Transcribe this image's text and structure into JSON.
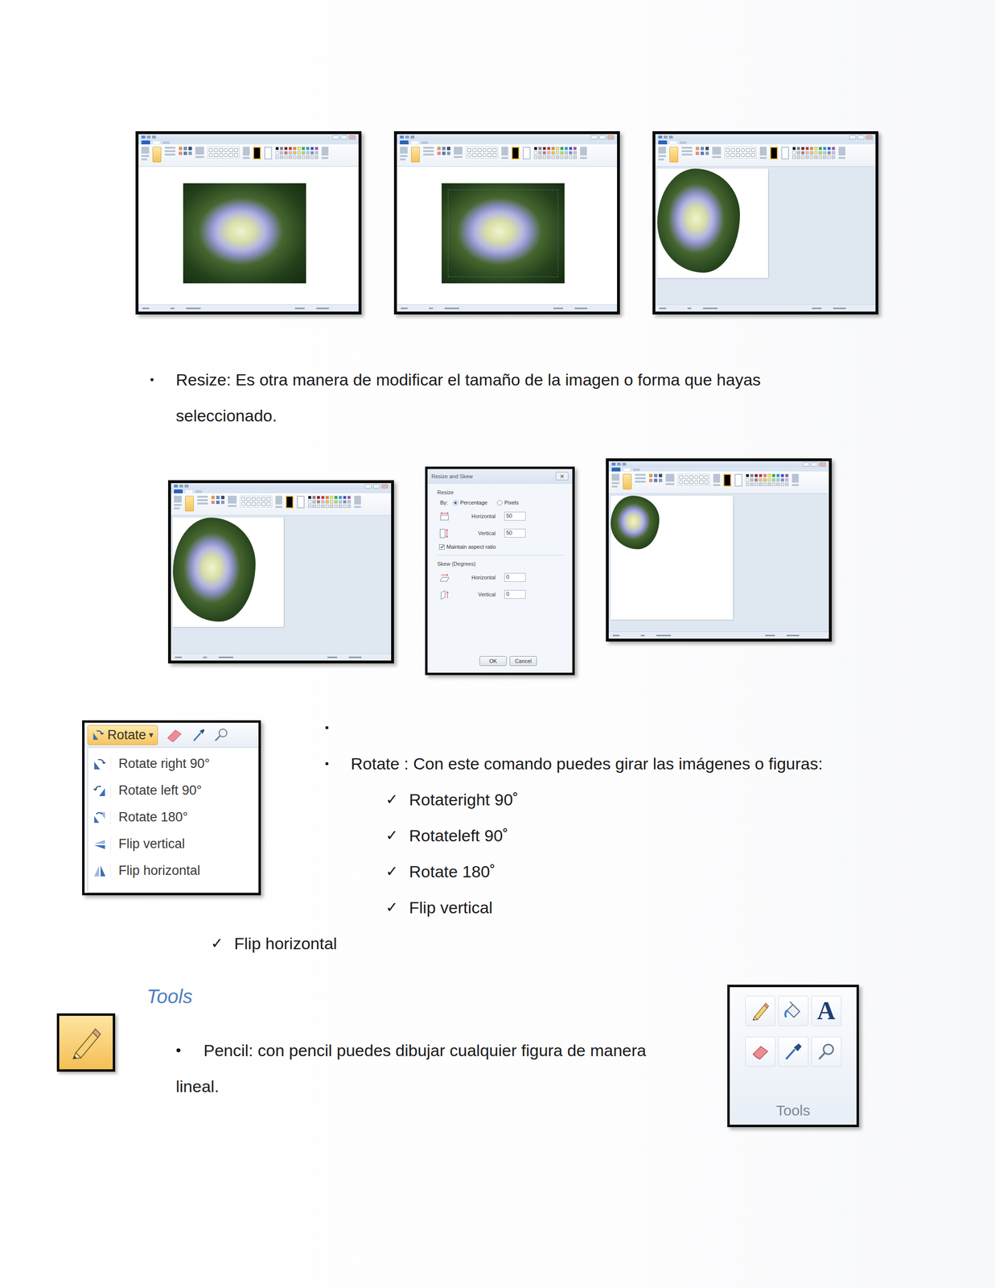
{
  "page": {
    "top_screenshots": [
      {
        "kind": "photo"
      },
      {
        "kind": "photo-selected"
      },
      {
        "kind": "cutout"
      }
    ],
    "resize": {
      "bullet": "▪",
      "lines": [
        "Resize: Es otra manera de modificar el tamaño de la imagen o forma que hayas",
        "seleccionado."
      ]
    },
    "resize_screenshots": {
      "before": {
        "kind": "cutout"
      },
      "dialog": {
        "title": "Resize and Skew",
        "resize": {
          "label": "Resize",
          "by_label": "By:",
          "options": [
            {
              "label": "Percentage",
              "selected": true
            },
            {
              "label": "Pixels",
              "selected": false
            }
          ],
          "fields": [
            {
              "label": "Horizontal",
              "value": "50",
              "kind": "resize-horizontal"
            },
            {
              "label": "Vertical",
              "value": "50",
              "kind": "resize-vertical"
            }
          ],
          "maintain": {
            "label": "Maintain aspect ratio",
            "checked": true
          }
        },
        "skew": {
          "label": "Skew (Degrees)",
          "fields": [
            {
              "label": "Horizontal",
              "value": "0",
              "kind": "skew-horizontal"
            },
            {
              "label": "Vertical",
              "value": "0",
              "kind": "skew-vertical"
            }
          ]
        },
        "buttons": [
          "OK",
          "Cancel"
        ]
      },
      "after": {
        "kind": "cutout-small"
      }
    },
    "rotate": {
      "menu": {
        "button": "Rotate",
        "arrow": "▾",
        "items": [
          {
            "label": "Rotate right 90°",
            "kind": "rotate-right"
          },
          {
            "label": "Rotate left 90°",
            "kind": "rotate-left"
          },
          {
            "label": "Rotate 180°",
            "kind": "rotate-180"
          },
          {
            "label": "Flip vertical",
            "kind": "flip-vertical"
          },
          {
            "label": "Flip horizontal",
            "kind": "flip-horizontal"
          }
        ]
      },
      "bullet": "▪",
      "bullet_items": [
        "",
        "Rotate : Con este comando puedes girar las imágenes o figuras:"
      ],
      "check": "✓",
      "options": [
        "Rotateright 90˚",
        "Rotateleft 90˚",
        "Rotate 180˚",
        "Flip vertical",
        "Flip horizontal"
      ]
    },
    "tools": {
      "heading": "Tools",
      "bullet": "•",
      "lines": [
        "Pencil: con pencil puedes dibujar cualquier figura de manera",
        "lineal."
      ],
      "panel": {
        "text_glyph": "A",
        "label": "Tools"
      }
    }
  }
}
